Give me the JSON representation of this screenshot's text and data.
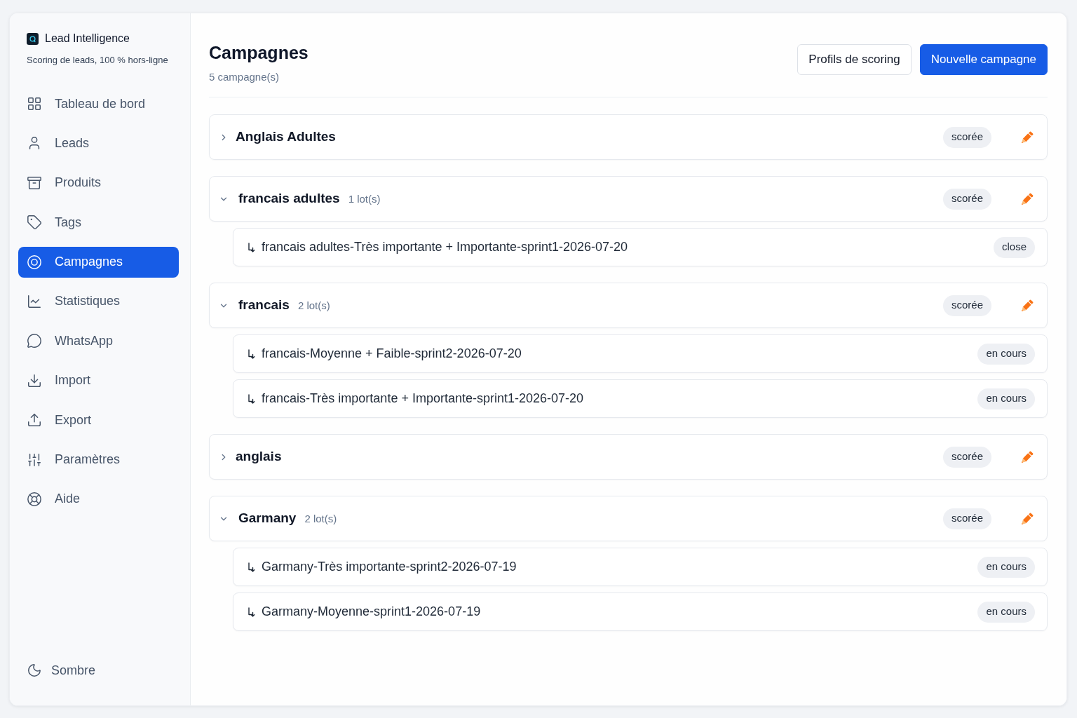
{
  "sidebar": {
    "logo_text": "Lead Intelligence",
    "tagline": "Scoring de leads, 100 % hors-ligne",
    "items": [
      {
        "label": "Tableau de bord",
        "selected": false
      },
      {
        "label": "Leads",
        "selected": false
      },
      {
        "label": "Produits",
        "selected": false
      },
      {
        "label": "Tags",
        "selected": false
      },
      {
        "label": "Campagnes",
        "selected": true
      },
      {
        "label": "Statistiques",
        "selected": false
      },
      {
        "label": "WhatsApp",
        "selected": false
      },
      {
        "label": "Import",
        "selected": false
      },
      {
        "label": "Export",
        "selected": false
      },
      {
        "label": "Paramètres",
        "selected": false
      },
      {
        "label": "Aide",
        "selected": false
      }
    ],
    "theme_toggle": "Sombre"
  },
  "header": {
    "title": "Campagnes",
    "subtitle": "5 campagne(s)",
    "buttons": [
      {
        "label": "Profils de scoring",
        "kind": "secondary"
      },
      {
        "label": "Nouvelle campagne",
        "kind": "primary"
      }
    ]
  },
  "campaigns": [
    {
      "name": "Anglais Adultes",
      "expanded": false,
      "status": "scorée"
    },
    {
      "name": "francais adultes",
      "count": "1 lot(s)",
      "expanded": true,
      "status": "scorée",
      "children": [
        {
          "name": "francais adultes-Très importante + Importante-sprint1-2026-07-20",
          "status": "close"
        }
      ]
    },
    {
      "name": "francais",
      "count": "2 lot(s)",
      "expanded": true,
      "status": "scorée",
      "children": [
        {
          "name": "francais-Moyenne + Faible-sprint2-2026-07-20",
          "status": "en cours"
        },
        {
          "name": "francais-Très importante + Importante-sprint1-2026-07-20",
          "status": "en cours"
        }
      ]
    },
    {
      "name": "anglais",
      "expanded": false,
      "status": "scorée"
    },
    {
      "name": "Garmany",
      "count": "2 lot(s)",
      "expanded": true,
      "status": "scorée",
      "children": [
        {
          "name": "Garmany-Très importante-sprint2-2026-07-19",
          "status": "en cours"
        },
        {
          "name": "Garmany-Moyenne-sprint1-2026-07-19",
          "status": "en cours"
        }
      ]
    }
  ]
}
